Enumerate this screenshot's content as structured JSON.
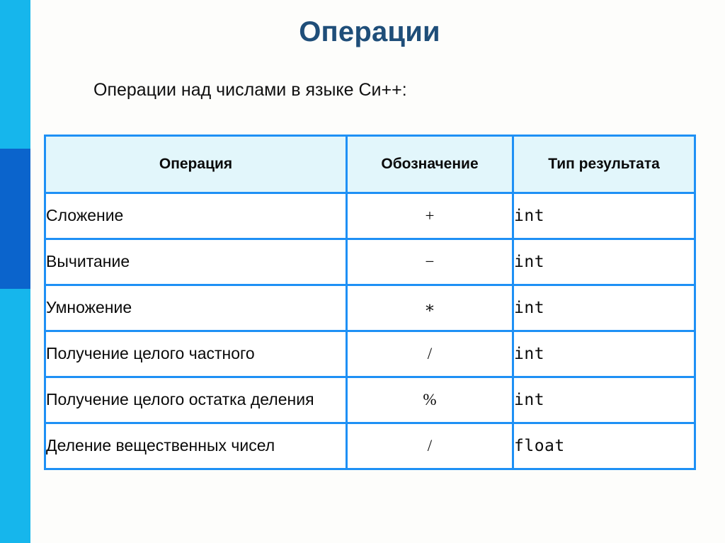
{
  "slide": {
    "title": "Операции",
    "subtitle": "Операции над числами в языке Си++:",
    "title_color": "#1F4E79",
    "rail_color": "#16B6EC",
    "rail_accent_color": "#0B64CC",
    "table_border_color": "#1E90F5",
    "header_fill_color": "#E2F6FB",
    "background_color": "#FDFDFB"
  },
  "table": {
    "headers": [
      "Операция",
      "Обозначение",
      "Тип результата"
    ],
    "rows": [
      {
        "operation": "Сложение",
        "symbol": "+",
        "result_type": "int"
      },
      {
        "operation": "Вычитание",
        "symbol": "−",
        "result_type": "int"
      },
      {
        "operation": "Умножение",
        "symbol": "∗",
        "result_type": "int"
      },
      {
        "operation": "Получение целого частного",
        "symbol": "/",
        "result_type": "int"
      },
      {
        "operation": "Получение целого остатка деления",
        "symbol": "%",
        "result_type": "int"
      },
      {
        "operation": "Деление вещественных чисел",
        "symbol": "/",
        "result_type": "float"
      }
    ]
  }
}
